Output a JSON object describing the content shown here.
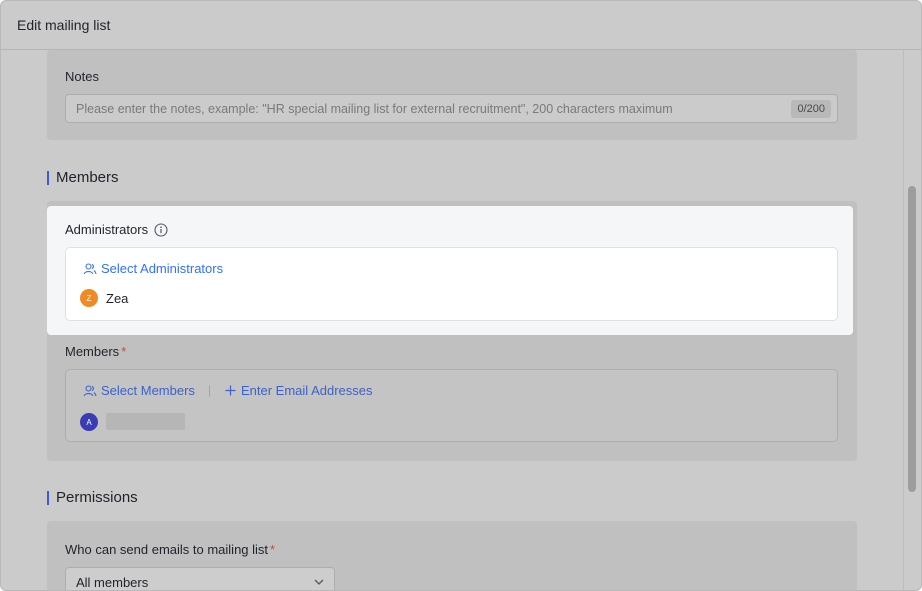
{
  "window": {
    "title": "Edit mailing list"
  },
  "notes": {
    "label": "Notes",
    "placeholder": "Please enter the notes, example: \"HR special mailing list for external recruitment\", 200 characters maximum",
    "counter": "0/200"
  },
  "members_section": {
    "title": "Members",
    "administrators": {
      "label": "Administrators",
      "select_label": "Select Administrators",
      "items": [
        {
          "initial": "Z",
          "name": "Zea",
          "color": "#f08a24"
        }
      ]
    },
    "members": {
      "label": "Members",
      "required": "*",
      "select_label": "Select Members",
      "divider": "|",
      "enter_emails_label": "Enter Email Addresses",
      "items": [
        {
          "initial": "A",
          "color": "#3b3bb5"
        }
      ]
    }
  },
  "permissions_section": {
    "title": "Permissions",
    "who_can_send": {
      "label": "Who can send emails to mailing list",
      "required": "*",
      "value": "All members"
    }
  },
  "colors": {
    "accent": "#3370ff",
    "section_bar": "#3b5bdb",
    "required": "#c64a3f"
  }
}
